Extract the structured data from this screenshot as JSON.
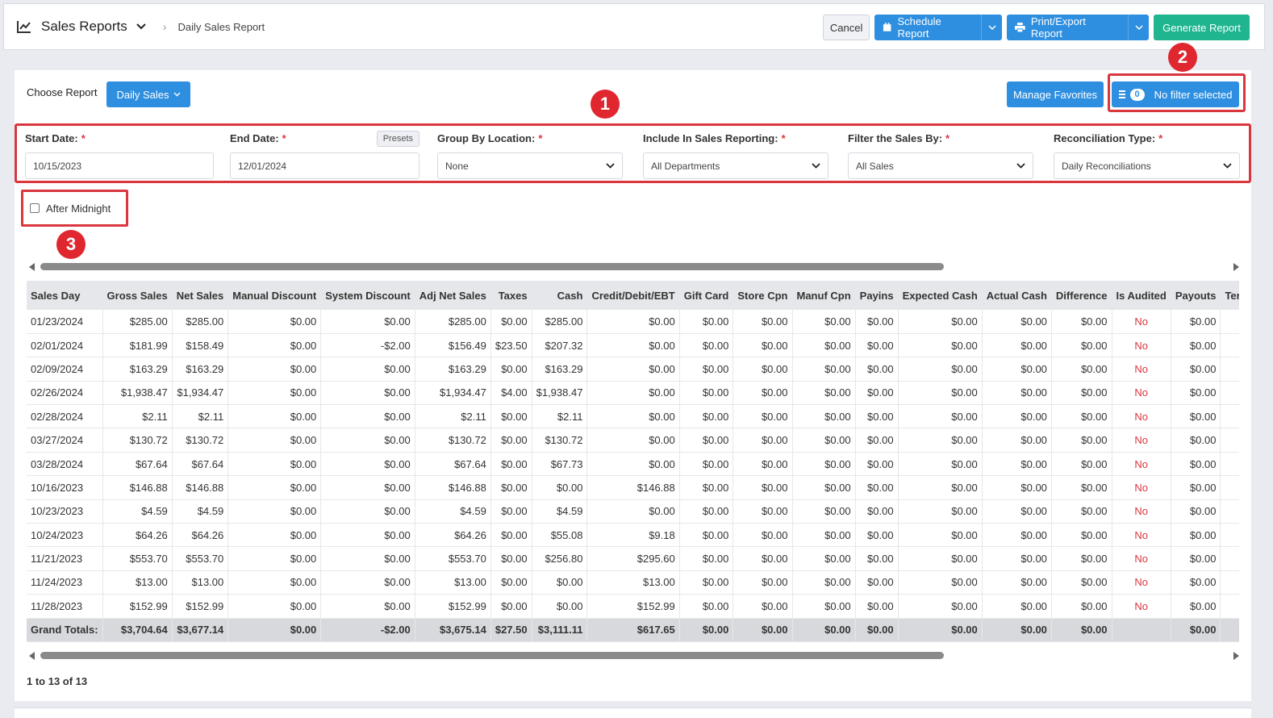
{
  "header": {
    "title": "Sales Reports",
    "breadcrumb": "Daily Sales Report",
    "cancel_label": "Cancel",
    "schedule_label": "Schedule Report",
    "print_label": "Print/Export Report",
    "generate_label": "Generate Report"
  },
  "controls": {
    "choose_label": "Choose Report",
    "report_select": "Daily Sales",
    "favorites_label": "Manage Favorites",
    "filter_count": "0",
    "filter_label": "No filter selected"
  },
  "filters": {
    "start_label": "Start Date:",
    "start_value": "10/15/2023",
    "end_label": "End Date:",
    "end_value": "12/01/2024",
    "presets_label": "Presets",
    "group_label": "Group By Location:",
    "group_value": "None",
    "include_label": "Include In Sales Reporting:",
    "include_value": "All Departments",
    "filter_by_label": "Filter the Sales By:",
    "filter_by_value": "All Sales",
    "recon_label": "Reconciliation Type:",
    "recon_value": "Daily Reconciliations",
    "required_mark": "*"
  },
  "after_midnight_label": "After Midnight",
  "markers": [
    "1",
    "2",
    "3"
  ],
  "table": {
    "columns": [
      "Sales Day",
      "Gross Sales",
      "Net Sales",
      "Manual Discount",
      "System Discount",
      "Adj Net Sales",
      "Taxes",
      "Cash",
      "Credit/Debit/EBT",
      "Gift Card",
      "Store Cpn",
      "Manuf Cpn",
      "Payins",
      "Expected Cash",
      "Actual Cash",
      "Difference",
      "Is Audited",
      "Payouts",
      "Ter"
    ],
    "rows": [
      [
        "01/23/2024",
        "$285.00",
        "$285.00",
        "$0.00",
        "$0.00",
        "$285.00",
        "$0.00",
        "$285.00",
        "$0.00",
        "$0.00",
        "$0.00",
        "$0.00",
        "$0.00",
        "$0.00",
        "$0.00",
        "$0.00",
        "No",
        "$0.00",
        ""
      ],
      [
        "02/01/2024",
        "$181.99",
        "$158.49",
        "$0.00",
        "-$2.00",
        "$156.49",
        "$23.50",
        "$207.32",
        "$0.00",
        "$0.00",
        "$0.00",
        "$0.00",
        "$0.00",
        "$0.00",
        "$0.00",
        "$0.00",
        "No",
        "$0.00",
        ""
      ],
      [
        "02/09/2024",
        "$163.29",
        "$163.29",
        "$0.00",
        "$0.00",
        "$163.29",
        "$0.00",
        "$163.29",
        "$0.00",
        "$0.00",
        "$0.00",
        "$0.00",
        "$0.00",
        "$0.00",
        "$0.00",
        "$0.00",
        "No",
        "$0.00",
        ""
      ],
      [
        "02/26/2024",
        "$1,938.47",
        "$1,934.47",
        "$0.00",
        "$0.00",
        "$1,934.47",
        "$4.00",
        "$1,938.47",
        "$0.00",
        "$0.00",
        "$0.00",
        "$0.00",
        "$0.00",
        "$0.00",
        "$0.00",
        "$0.00",
        "No",
        "$0.00",
        ""
      ],
      [
        "02/28/2024",
        "$2.11",
        "$2.11",
        "$0.00",
        "$0.00",
        "$2.11",
        "$0.00",
        "$2.11",
        "$0.00",
        "$0.00",
        "$0.00",
        "$0.00",
        "$0.00",
        "$0.00",
        "$0.00",
        "$0.00",
        "No",
        "$0.00",
        ""
      ],
      [
        "03/27/2024",
        "$130.72",
        "$130.72",
        "$0.00",
        "$0.00",
        "$130.72",
        "$0.00",
        "$130.72",
        "$0.00",
        "$0.00",
        "$0.00",
        "$0.00",
        "$0.00",
        "$0.00",
        "$0.00",
        "$0.00",
        "No",
        "$0.00",
        ""
      ],
      [
        "03/28/2024",
        "$67.64",
        "$67.64",
        "$0.00",
        "$0.00",
        "$67.64",
        "$0.00",
        "$67.73",
        "$0.00",
        "$0.00",
        "$0.00",
        "$0.00",
        "$0.00",
        "$0.00",
        "$0.00",
        "$0.00",
        "No",
        "$0.00",
        ""
      ],
      [
        "10/16/2023",
        "$146.88",
        "$146.88",
        "$0.00",
        "$0.00",
        "$146.88",
        "$0.00",
        "$0.00",
        "$146.88",
        "$0.00",
        "$0.00",
        "$0.00",
        "$0.00",
        "$0.00",
        "$0.00",
        "$0.00",
        "No",
        "$0.00",
        ""
      ],
      [
        "10/23/2023",
        "$4.59",
        "$4.59",
        "$0.00",
        "$0.00",
        "$4.59",
        "$0.00",
        "$4.59",
        "$0.00",
        "$0.00",
        "$0.00",
        "$0.00",
        "$0.00",
        "$0.00",
        "$0.00",
        "$0.00",
        "No",
        "$0.00",
        ""
      ],
      [
        "10/24/2023",
        "$64.26",
        "$64.26",
        "$0.00",
        "$0.00",
        "$64.26",
        "$0.00",
        "$55.08",
        "$9.18",
        "$0.00",
        "$0.00",
        "$0.00",
        "$0.00",
        "$0.00",
        "$0.00",
        "$0.00",
        "No",
        "$0.00",
        ""
      ],
      [
        "11/21/2023",
        "$553.70",
        "$553.70",
        "$0.00",
        "$0.00",
        "$553.70",
        "$0.00",
        "$256.80",
        "$295.60",
        "$0.00",
        "$0.00",
        "$0.00",
        "$0.00",
        "$0.00",
        "$0.00",
        "$0.00",
        "No",
        "$0.00",
        ""
      ],
      [
        "11/24/2023",
        "$13.00",
        "$13.00",
        "$0.00",
        "$0.00",
        "$13.00",
        "$0.00",
        "$0.00",
        "$13.00",
        "$0.00",
        "$0.00",
        "$0.00",
        "$0.00",
        "$0.00",
        "$0.00",
        "$0.00",
        "No",
        "$0.00",
        ""
      ],
      [
        "11/28/2023",
        "$152.99",
        "$152.99",
        "$0.00",
        "$0.00",
        "$152.99",
        "$0.00",
        "$0.00",
        "$152.99",
        "$0.00",
        "$0.00",
        "$0.00",
        "$0.00",
        "$0.00",
        "$0.00",
        "$0.00",
        "No",
        "$0.00",
        ""
      ]
    ],
    "totals": [
      "Grand Totals:",
      "$3,704.64",
      "$3,677.14",
      "$0.00",
      "-$2.00",
      "$3,675.14",
      "$27.50",
      "$3,111.11",
      "$617.65",
      "$0.00",
      "$0.00",
      "$0.00",
      "$0.00",
      "$0.00",
      "$0.00",
      "$0.00",
      "",
      "$0.00",
      ""
    ]
  },
  "pager_text": "1 to 13 of 13",
  "colors": {
    "primary": "#2e8fe0",
    "success": "#1fb58f",
    "highlight": "#d9363e"
  }
}
